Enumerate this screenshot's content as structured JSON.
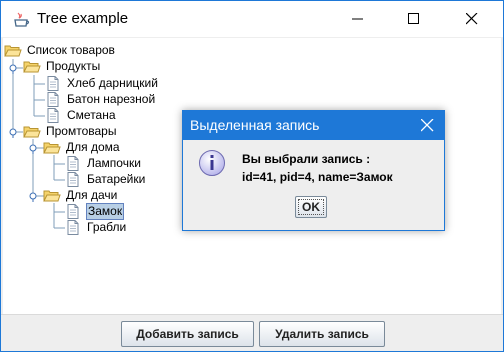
{
  "window": {
    "title": "Tree example"
  },
  "tree": {
    "root": "Список товаров",
    "products": "Продукты",
    "bread1": "Хлеб дарницкий",
    "bread2": "Батон нарезной",
    "cream": "Сметана",
    "goods": "Промтовары",
    "home": "Для дома",
    "bulbs": "Лампочки",
    "batteries": "Батарейки",
    "dacha": "Для дачи",
    "lock": "Замок",
    "rake": "Грабли",
    "selected": "Замок"
  },
  "buttons": {
    "add": "Добавить запись",
    "delete": "Удалить запись"
  },
  "dialog": {
    "title": "Выделенная запись",
    "line1": "Вы выбрали запись :",
    "line2": "id=41, pid=4, name=Замок",
    "ok": "OK"
  },
  "colors": {
    "accent": "#1e78d7",
    "selection": "#b8cfe5",
    "folder": "#f5d36b"
  }
}
